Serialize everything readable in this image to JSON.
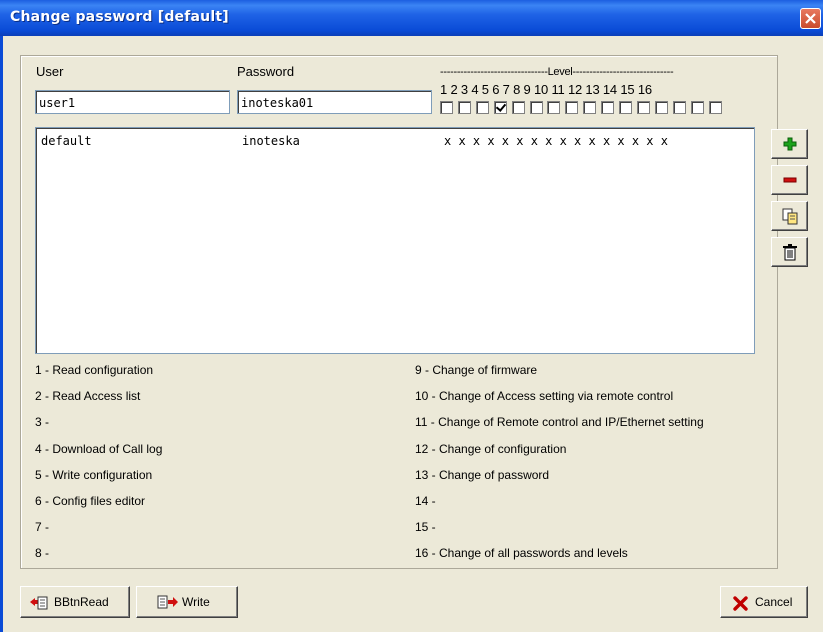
{
  "window": {
    "title": "Change password [default]"
  },
  "form": {
    "user_label": "User",
    "password_label": "Password",
    "user_value": "user1",
    "password_value": "inoteska01",
    "level_header": "--------------------------------Level------------------------------",
    "level_numbers": "1  2  3  4  5  6  7  8  9  10 11 12 13 14 15 16",
    "level_checked": [
      4
    ]
  },
  "list": {
    "rows": [
      {
        "user": "default",
        "password": "inoteska",
        "levels": "x x x x x x x x x x x x x x x x"
      }
    ]
  },
  "side_buttons": [
    {
      "name": "add-button",
      "icon": "plus-icon"
    },
    {
      "name": "remove-button",
      "icon": "minus-icon"
    },
    {
      "name": "copy-button",
      "icon": "copy-document-icon"
    },
    {
      "name": "delete-button",
      "icon": "trash-icon"
    }
  ],
  "legend": {
    "left": [
      "1 - Read configuration",
      "2 - Read Access list",
      "3 -",
      "4 - Download of Call log",
      "5 - Write configuration",
      "6 - Config files editor",
      "7 -",
      "8 -"
    ],
    "right": [
      "9 - Change of firmware",
      "10 - Change of Access setting via remote control",
      "11 - Change of Remote control and IP/Ethernet setting",
      "12 - Change of configuration",
      "13 - Change of password",
      "14 -",
      "15 -",
      "16 - Change of all passwords and levels"
    ]
  },
  "buttons": {
    "read_label": "BBtnRead",
    "write_label": "Write",
    "cancel_label": "Cancel"
  },
  "colors": {
    "titlebar": "#0a4bd6",
    "face": "#ece9d8",
    "close": "#c94b2c"
  }
}
